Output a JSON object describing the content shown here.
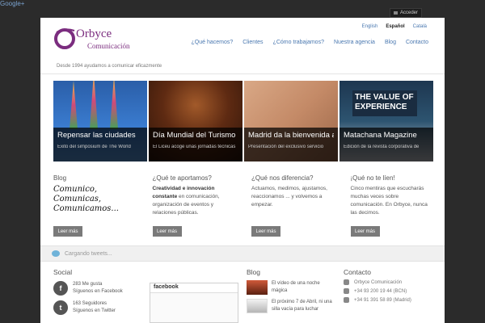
{
  "top": {
    "google_plus": "Google+",
    "login": "Acceder"
  },
  "header": {
    "logo_main": "Orbyce",
    "logo_sub": "Comunicación",
    "tagline": "Desde 1994 ayudamos a comunicar eficazmente",
    "languages": [
      "English",
      "Español",
      "Català"
    ],
    "nav": [
      "¿Qué hacemos?",
      "Clientes",
      "¿Cómo trabajamos?",
      "Nuestra agencia",
      "Blog",
      "Contacto"
    ]
  },
  "slides": [
    {
      "title": "Repensar las ciudades",
      "subtitle": "Éxito del simposium de The World"
    },
    {
      "title": "Día Mundial del Turismo",
      "subtitle": "El Liceu acoge unas jornadas técnicas"
    },
    {
      "title": "Madrid da la bienvenida a",
      "subtitle": "Presentación del exclusivo servicio"
    },
    {
      "title": "Matachana Magazine",
      "subtitle": "Edición de la revista corporativa de"
    }
  ],
  "slide4_overlay": "THE VALUE OF EXPERIENCE",
  "columns": [
    {
      "title": "Blog",
      "text": "Comunico, Comunicas, Comunicamos...",
      "button": "Leer más"
    },
    {
      "title": "¿Qué te aportamos?",
      "bold": "Creatividad e innovación constante",
      "text": " en comunicación, organización de eventos y relaciones públicas.",
      "button": "Leer más"
    },
    {
      "title": "¿Qué nos diferencia?",
      "text": "Actuamos, medimos, ajustamos, reaccionamos ... y volvemos a empezar.",
      "button": "Leer más"
    },
    {
      "title": "¡Qué no te líen!",
      "text": "Cinco mentiras que escucharás muchas veces sobre comunicación. En Orbyce, nunca las decimos.",
      "button": "Leer más"
    }
  ],
  "tweets": {
    "loading": "Cargando tweets..."
  },
  "footer": {
    "social": {
      "title": "Social",
      "facebook": {
        "count": "283 Me gusta",
        "label": "Síguenos en Facebook"
      },
      "twitter": {
        "count": "163 Seguidores",
        "label": "Síguenos en Twitter"
      },
      "fb_box": "facebook"
    },
    "blog": {
      "title": "Blog",
      "items": [
        "El vídeo de una noche mágica",
        "El próximo 7 de Abril, ni una silla vacía para luchar"
      ]
    },
    "contact": {
      "title": "Contacto",
      "items": [
        "Orbyce Comunicación",
        "+34 93 200 19 44 (BCN)",
        "+34 91 391 58 89 (Madrid)"
      ]
    }
  }
}
